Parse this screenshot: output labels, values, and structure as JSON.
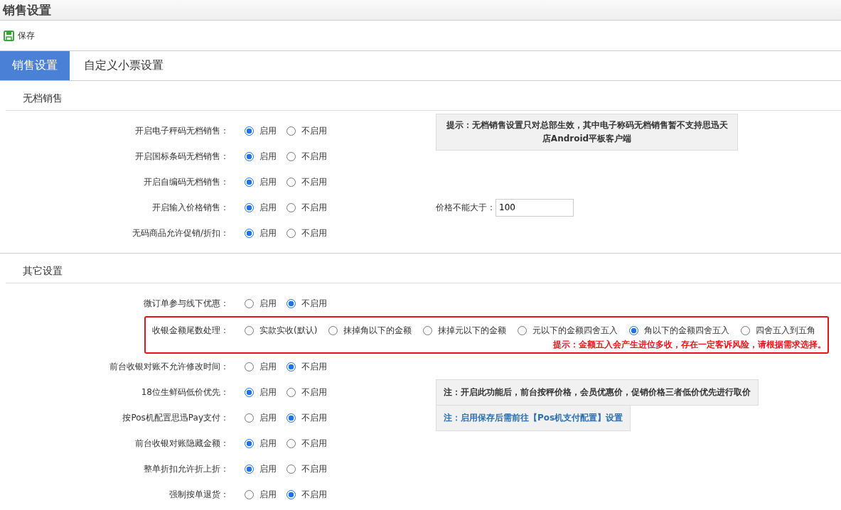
{
  "title": "销售设置",
  "toolbar": {
    "save_label": "保存"
  },
  "tabs": [
    {
      "label": "销售设置",
      "selected": true
    },
    {
      "label": "自定义小票设置",
      "selected": false
    }
  ],
  "sections": [
    {
      "title": "无档销售",
      "rows": [
        {
          "label": "开启电子秤码无档销售：",
          "options": [
            {
              "label": "启用",
              "selected": true
            },
            {
              "label": "不启用",
              "selected": false
            }
          ],
          "side": {
            "kind": "note",
            "text": "提示：无档销售设置只对总部生效，其中电子称码无档销售暂不支持思迅天店Android平板客户端"
          }
        },
        {
          "label": "开启国标条码无档销售：",
          "options": [
            {
              "label": "启用",
              "selected": true
            },
            {
              "label": "不启用",
              "selected": false
            }
          ]
        },
        {
          "label": "开启自编码无档销售：",
          "options": [
            {
              "label": "启用",
              "selected": true
            },
            {
              "label": "不启用",
              "selected": false
            }
          ]
        },
        {
          "label": "开启输入价格销售：",
          "options": [
            {
              "label": "启用",
              "selected": true
            },
            {
              "label": "不启用",
              "selected": false
            }
          ],
          "side": {
            "kind": "input",
            "label": "价格不能大于：",
            "value": "100"
          }
        },
        {
          "label": "无码商品允许促销/折扣：",
          "options": [
            {
              "label": "启用",
              "selected": true
            },
            {
              "label": "不启用",
              "selected": false
            }
          ]
        }
      ]
    },
    {
      "title": "其它设置",
      "rows": [
        {
          "label": "微订单参与线下优惠：",
          "options": [
            {
              "label": "启用",
              "selected": false
            },
            {
              "label": "不启用",
              "selected": true
            }
          ]
        },
        {
          "label": "收银金额尾数处理：",
          "highlighted": true,
          "warning": "提示：金额五入会产生进位多收，存在一定客诉风险，请根据需求选择。",
          "options": [
            {
              "label": "实款实收(默认)",
              "selected": false
            },
            {
              "label": "抹掉角以下的金额",
              "selected": false
            },
            {
              "label": "抹掉元以下的金额",
              "selected": false
            },
            {
              "label": "元以下的金额四舍五入",
              "selected": false
            },
            {
              "label": "角以下的金额四舍五入",
              "selected": true
            },
            {
              "label": "四舍五入到五角",
              "selected": false
            }
          ]
        },
        {
          "label": "前台收银对账不允许修改时间：",
          "options": [
            {
              "label": "启用",
              "selected": false
            },
            {
              "label": "不启用",
              "selected": true
            }
          ]
        },
        {
          "label": "18位生鲜码低价优先：",
          "options": [
            {
              "label": "启用",
              "selected": true
            },
            {
              "label": "不启用",
              "selected": false
            }
          ],
          "side": {
            "kind": "note",
            "text": "注：开启此功能后，前台按秤价格，会员优惠价，促销价格三者低价优先进行取价"
          }
        },
        {
          "label": "按Pos机配置思迅Pay支付：",
          "options": [
            {
              "label": "启用",
              "selected": false
            },
            {
              "label": "不启用",
              "selected": true
            }
          ],
          "side": {
            "kind": "link_note",
            "text": "注：启用保存后需前往【Pos机支付配置】设置"
          }
        },
        {
          "label": "前台收银对账隐藏金额：",
          "options": [
            {
              "label": "启用",
              "selected": true
            },
            {
              "label": "不启用",
              "selected": false
            }
          ]
        },
        {
          "label": "整单折扣允许折上折：",
          "options": [
            {
              "label": "启用",
              "selected": true
            },
            {
              "label": "不启用",
              "selected": false
            }
          ]
        },
        {
          "label": "强制按单退货：",
          "options": [
            {
              "label": "启用",
              "selected": false
            },
            {
              "label": "不启用",
              "selected": true
            }
          ]
        }
      ]
    }
  ]
}
